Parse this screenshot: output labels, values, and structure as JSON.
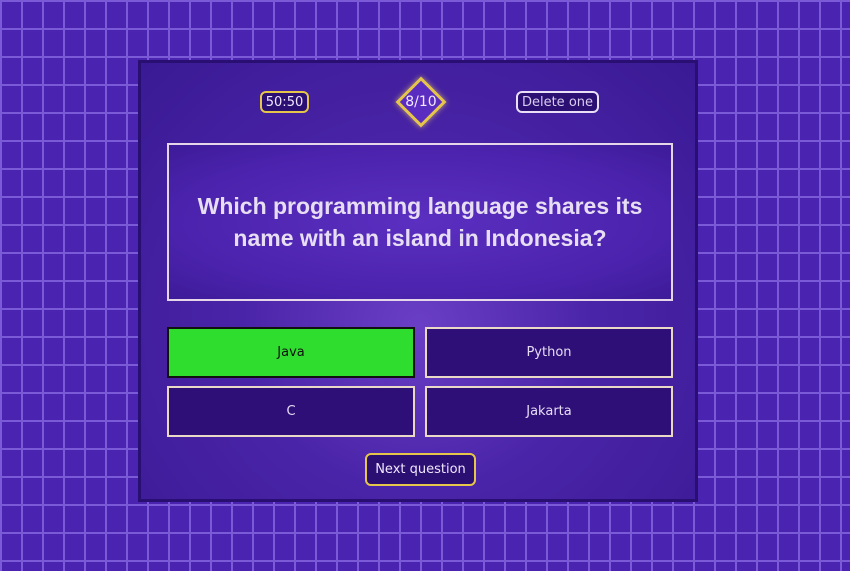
{
  "lifelines": {
    "fifty_fifty_label": "50:50",
    "delete_one_label": "Delete one"
  },
  "progress": {
    "label": "8/10",
    "current": 8,
    "total": 10
  },
  "question": {
    "text": "Which programming language shares its name with an island in Indonesia?"
  },
  "answers": [
    {
      "label": "Java",
      "state": "correct"
    },
    {
      "label": "Python",
      "state": "default"
    },
    {
      "label": "C",
      "state": "default"
    },
    {
      "label": "Jakarta",
      "state": "default"
    }
  ],
  "next_button": {
    "label": "Next question"
  },
  "colors": {
    "background": "#4a23b0",
    "brick_mortar": "#7a5ad6",
    "panel": "#3a1a94",
    "gold_accent": "#e6c64a",
    "correct_answer": "#2fdd2f",
    "answer_box": "#2e0f78"
  }
}
